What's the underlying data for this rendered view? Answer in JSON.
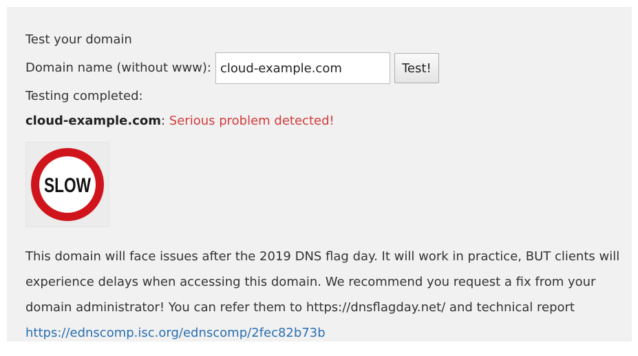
{
  "form": {
    "heading": "Test your domain",
    "domain_label": "Domain name (without www):",
    "domain_value": "cloud-example.com",
    "test_button_label": "Test!"
  },
  "result": {
    "status": "Testing completed:",
    "domain": "cloud-example.com",
    "separator": ": ",
    "message": "Serious problem detected!",
    "icon_text": "SLOW",
    "description": "This domain will face issues after the 2019 DNS flag day. It will work in practice, BUT clients will experience delays when accessing this domain. We recommend you request a fix from your domain administrator! You can refer them to https://dnsflagday.net/ and technical report",
    "report_link": "https://ednscomp.isc.org/ednscomp/2fec82b73b"
  },
  "colors": {
    "panel_background": "#f1f1f1",
    "error_text": "#d23b3b",
    "link": "#2a6fb0",
    "slow_sign_ring": "#d0141b"
  },
  "icons": {
    "slow_sign": "slow-sign-icon"
  }
}
